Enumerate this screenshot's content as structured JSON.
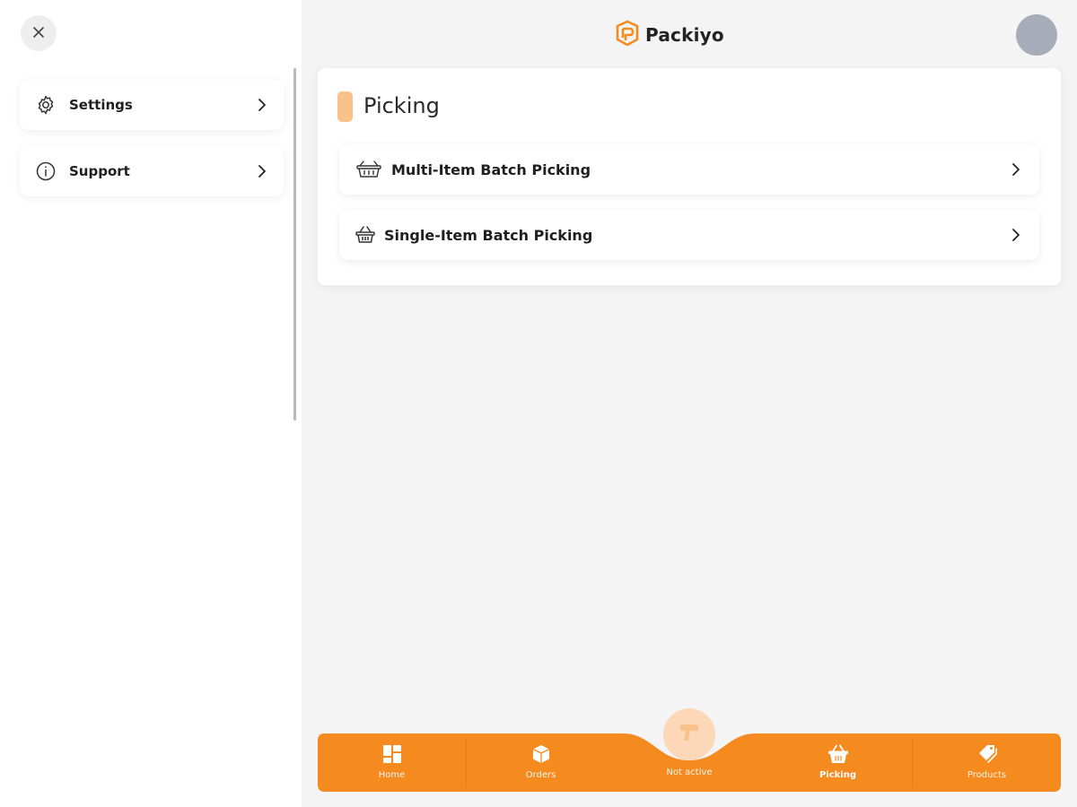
{
  "drawer": {
    "items": [
      {
        "label": "Settings",
        "icon": "gear-icon"
      },
      {
        "label": "Support",
        "icon": "info-icon"
      }
    ]
  },
  "header": {
    "brand": "Packiyo"
  },
  "picking": {
    "title": "Picking",
    "rows": [
      {
        "label": "Multi-Item Batch Picking",
        "icon": "multi-basket-icon"
      },
      {
        "label": "Single-Item Batch Picking",
        "icon": "basket-icon"
      }
    ]
  },
  "bottom_nav": {
    "items": [
      {
        "label": "Home",
        "icon": "grid-icon"
      },
      {
        "label": "Orders",
        "icon": "box-icon"
      },
      {
        "label": "Not active",
        "icon": "scanner-icon"
      },
      {
        "label": "Picking",
        "icon": "basket-icon",
        "active": true
      },
      {
        "label": "Products",
        "icon": "tags-icon"
      }
    ]
  },
  "colors": {
    "brand": "#f58a1f",
    "accent_light": "#f9c28a",
    "background": "#f4f4f4",
    "avatar": "#a6adb8"
  }
}
